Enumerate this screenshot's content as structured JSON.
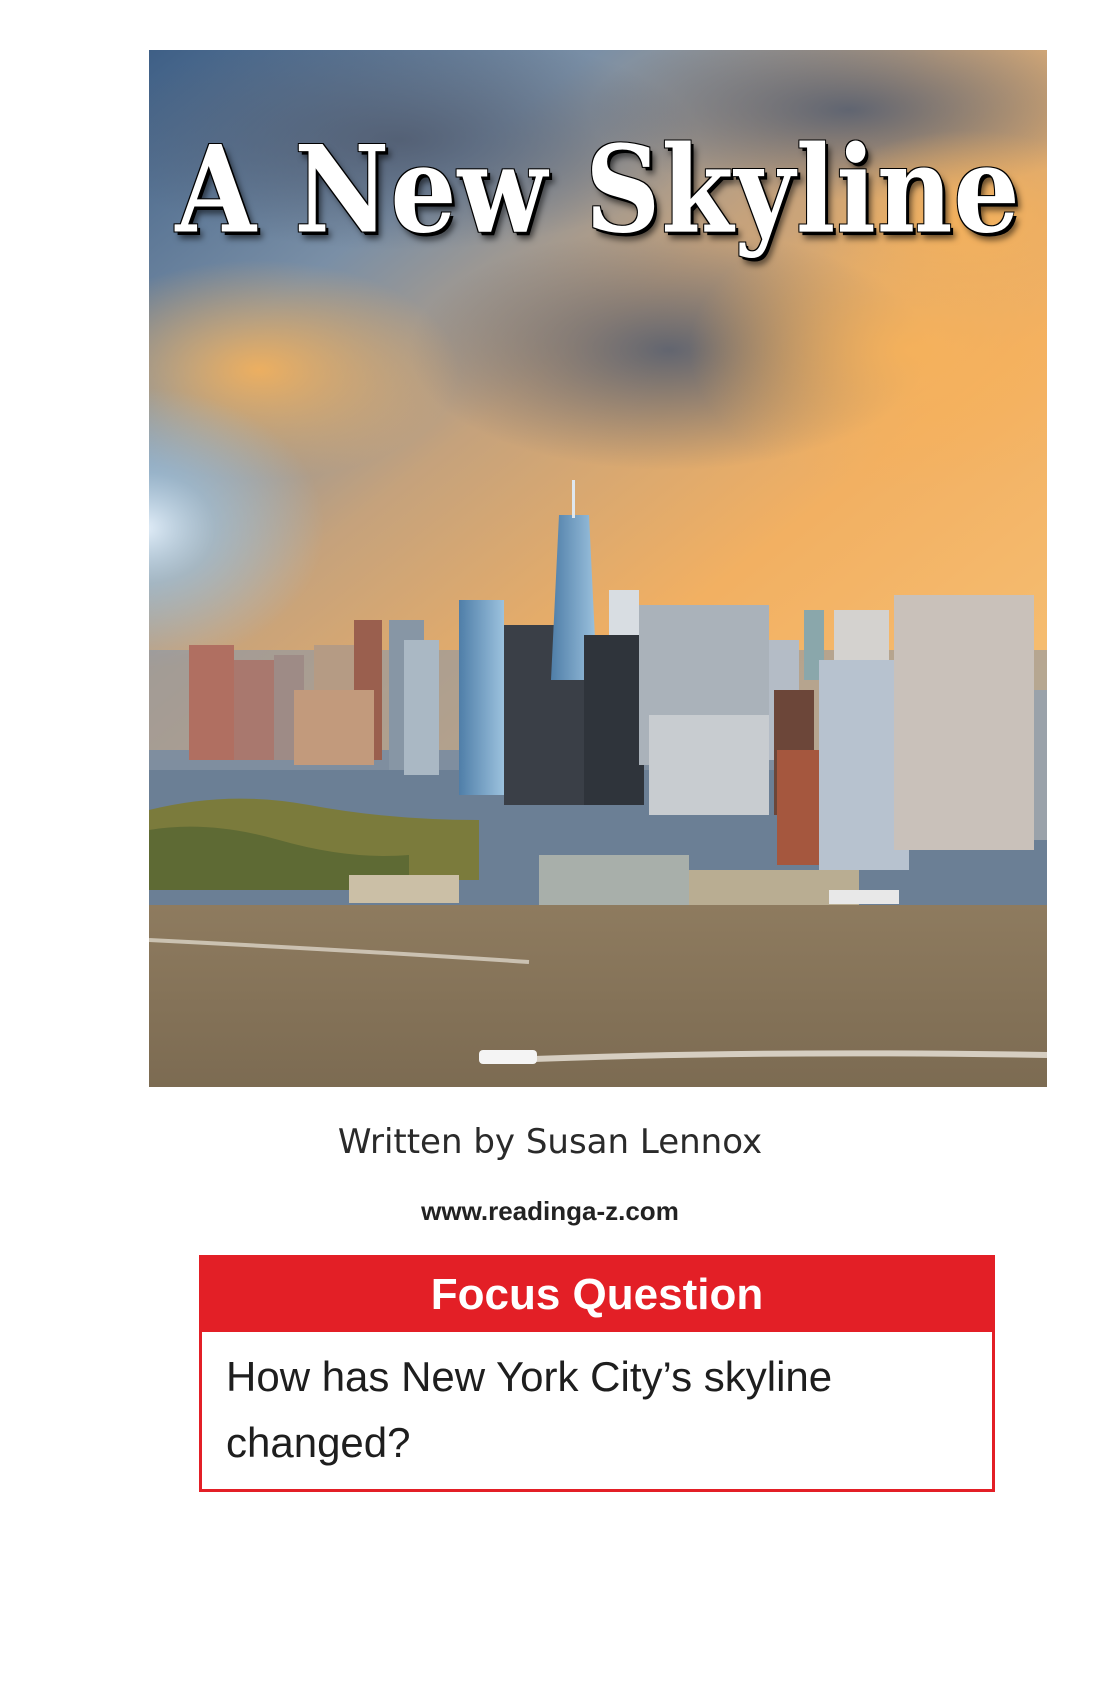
{
  "cover": {
    "title": "A New Skyline",
    "image_description_icon": "city-skyline-photo",
    "colors": {
      "sky_blue": "#5f86ad",
      "sky_orange": "#f2a54f",
      "water": "#8a7a5f",
      "trees": "#7a7a3a"
    }
  },
  "credits": {
    "author": "Written by Susan Lennox",
    "website": "www.readinga-z.com"
  },
  "focus": {
    "header": "Focus Question",
    "question": "How has New York City’s skyline changed?",
    "accent_color": "#e31f26"
  }
}
